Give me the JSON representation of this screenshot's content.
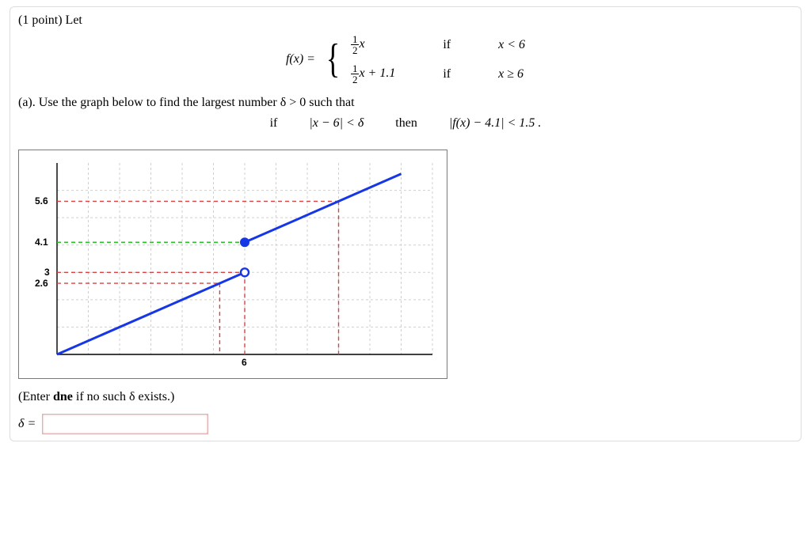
{
  "header": {
    "points": "(1 point)",
    "let": "Let"
  },
  "func": {
    "lhs": "f(x) =",
    "case1_expr_frac_num": "1",
    "case1_expr_frac_den": "2",
    "case1_expr_tail": "x",
    "case1_if": "if",
    "case1_cond": "x < 6",
    "case2_expr_frac_num": "1",
    "case2_expr_frac_den": "2",
    "case2_expr_tail": "x + 1.1",
    "case2_if": "if",
    "case2_cond": "x ≥ 6"
  },
  "partA": {
    "text": "(a). Use the graph below to find the largest number δ > 0 such that"
  },
  "cond": {
    "if": "if",
    "lhs": "|x − 6| < δ",
    "then": "then",
    "rhs": "|f(x) − 4.1| < 1.5 ."
  },
  "graph": {
    "y_ticks": [
      "5.6",
      "4.1",
      "3",
      "2.6"
    ],
    "x_ticks": [
      "6"
    ]
  },
  "chart_data": {
    "type": "line",
    "title": "",
    "xlabel": "",
    "ylabel": "",
    "xlim": [
      0,
      12
    ],
    "ylim": [
      0,
      7
    ],
    "series": [
      {
        "name": "f_left",
        "x": [
          0,
          6
        ],
        "y": [
          0.0,
          3.0
        ],
        "note": "open at x=6"
      },
      {
        "name": "f_right",
        "x": [
          6,
          12
        ],
        "y": [
          4.1,
          7.1
        ],
        "note": "closed at x=6"
      }
    ],
    "guides": {
      "y_lines": [
        5.6,
        4.1,
        3.0,
        2.6
      ],
      "x_lines": [
        5.2,
        6.0,
        9.0
      ]
    },
    "y_ticks_labeled": [
      5.6,
      4.1,
      3,
      2.6
    ],
    "x_ticks_labeled": [
      6
    ]
  },
  "hint": {
    "pre": "(Enter ",
    "kw": "dne",
    "post": " if no such δ exists.)"
  },
  "answer": {
    "label": "δ ="
  }
}
